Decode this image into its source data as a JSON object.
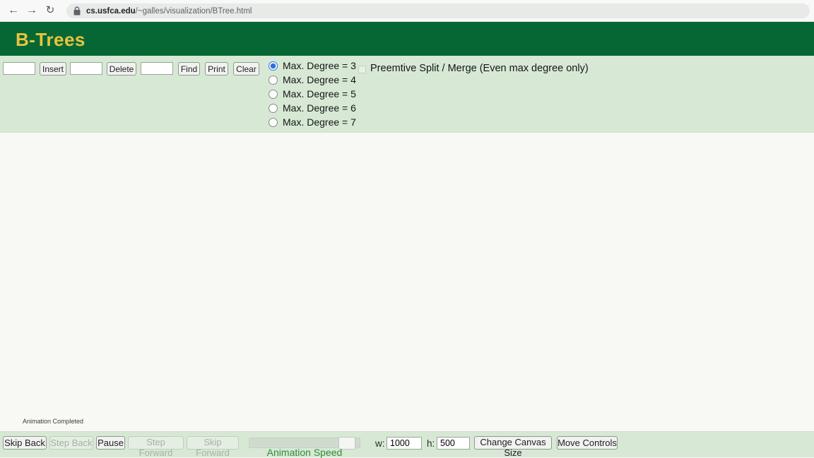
{
  "browser": {
    "back_icon": "arrow-left",
    "forward_icon": "arrow-right",
    "reload_icon": "reload-circle",
    "lock_icon": "padlock",
    "url_host": "cs.usfca.edu",
    "url_path": "/~galles/visualization/BTree.html"
  },
  "header": {
    "title": "B-Trees"
  },
  "controls": {
    "insert_value": "",
    "insert_button": "Insert",
    "delete_value": "",
    "delete_button": "Delete",
    "find_value": "",
    "find_button": "Find",
    "print_button": "Print",
    "clear_button": "Clear",
    "radios": [
      {
        "label": "Max. Degree = 3",
        "selected": true
      },
      {
        "label": "Max. Degree = 4",
        "selected": false
      },
      {
        "label": "Max. Degree = 5",
        "selected": false
      },
      {
        "label": "Max. Degree = 6",
        "selected": false
      },
      {
        "label": "Max. Degree = 7",
        "selected": false
      }
    ],
    "preemptive_checkbox": {
      "label": "Preemtive Split / Merge (Even max degree only)",
      "checked": false
    }
  },
  "canvas": {
    "status_text": "Animation Completed"
  },
  "playback": {
    "buttons": [
      {
        "label": "Skip Back",
        "disabled": false
      },
      {
        "label": "Step Back",
        "disabled": true
      },
      {
        "label": "Pause",
        "disabled": false
      },
      {
        "label": "Step Forward",
        "disabled": true
      },
      {
        "label": "Skip Forward",
        "disabled": true
      }
    ],
    "speed_label": "Animation Speed",
    "width_label": "w:",
    "width_value": "1000",
    "height_label": "h:",
    "height_value": "500",
    "change_canvas_button": "Change Canvas Size",
    "move_controls_button": "Move Controls"
  },
  "colors": {
    "header_green": "#076734",
    "panel_green": "#d7e9d5",
    "title_gold": "#e8c43f",
    "speed_text_green": "#2f8b3c",
    "radio_selected_blue": "#2f72d9"
  }
}
